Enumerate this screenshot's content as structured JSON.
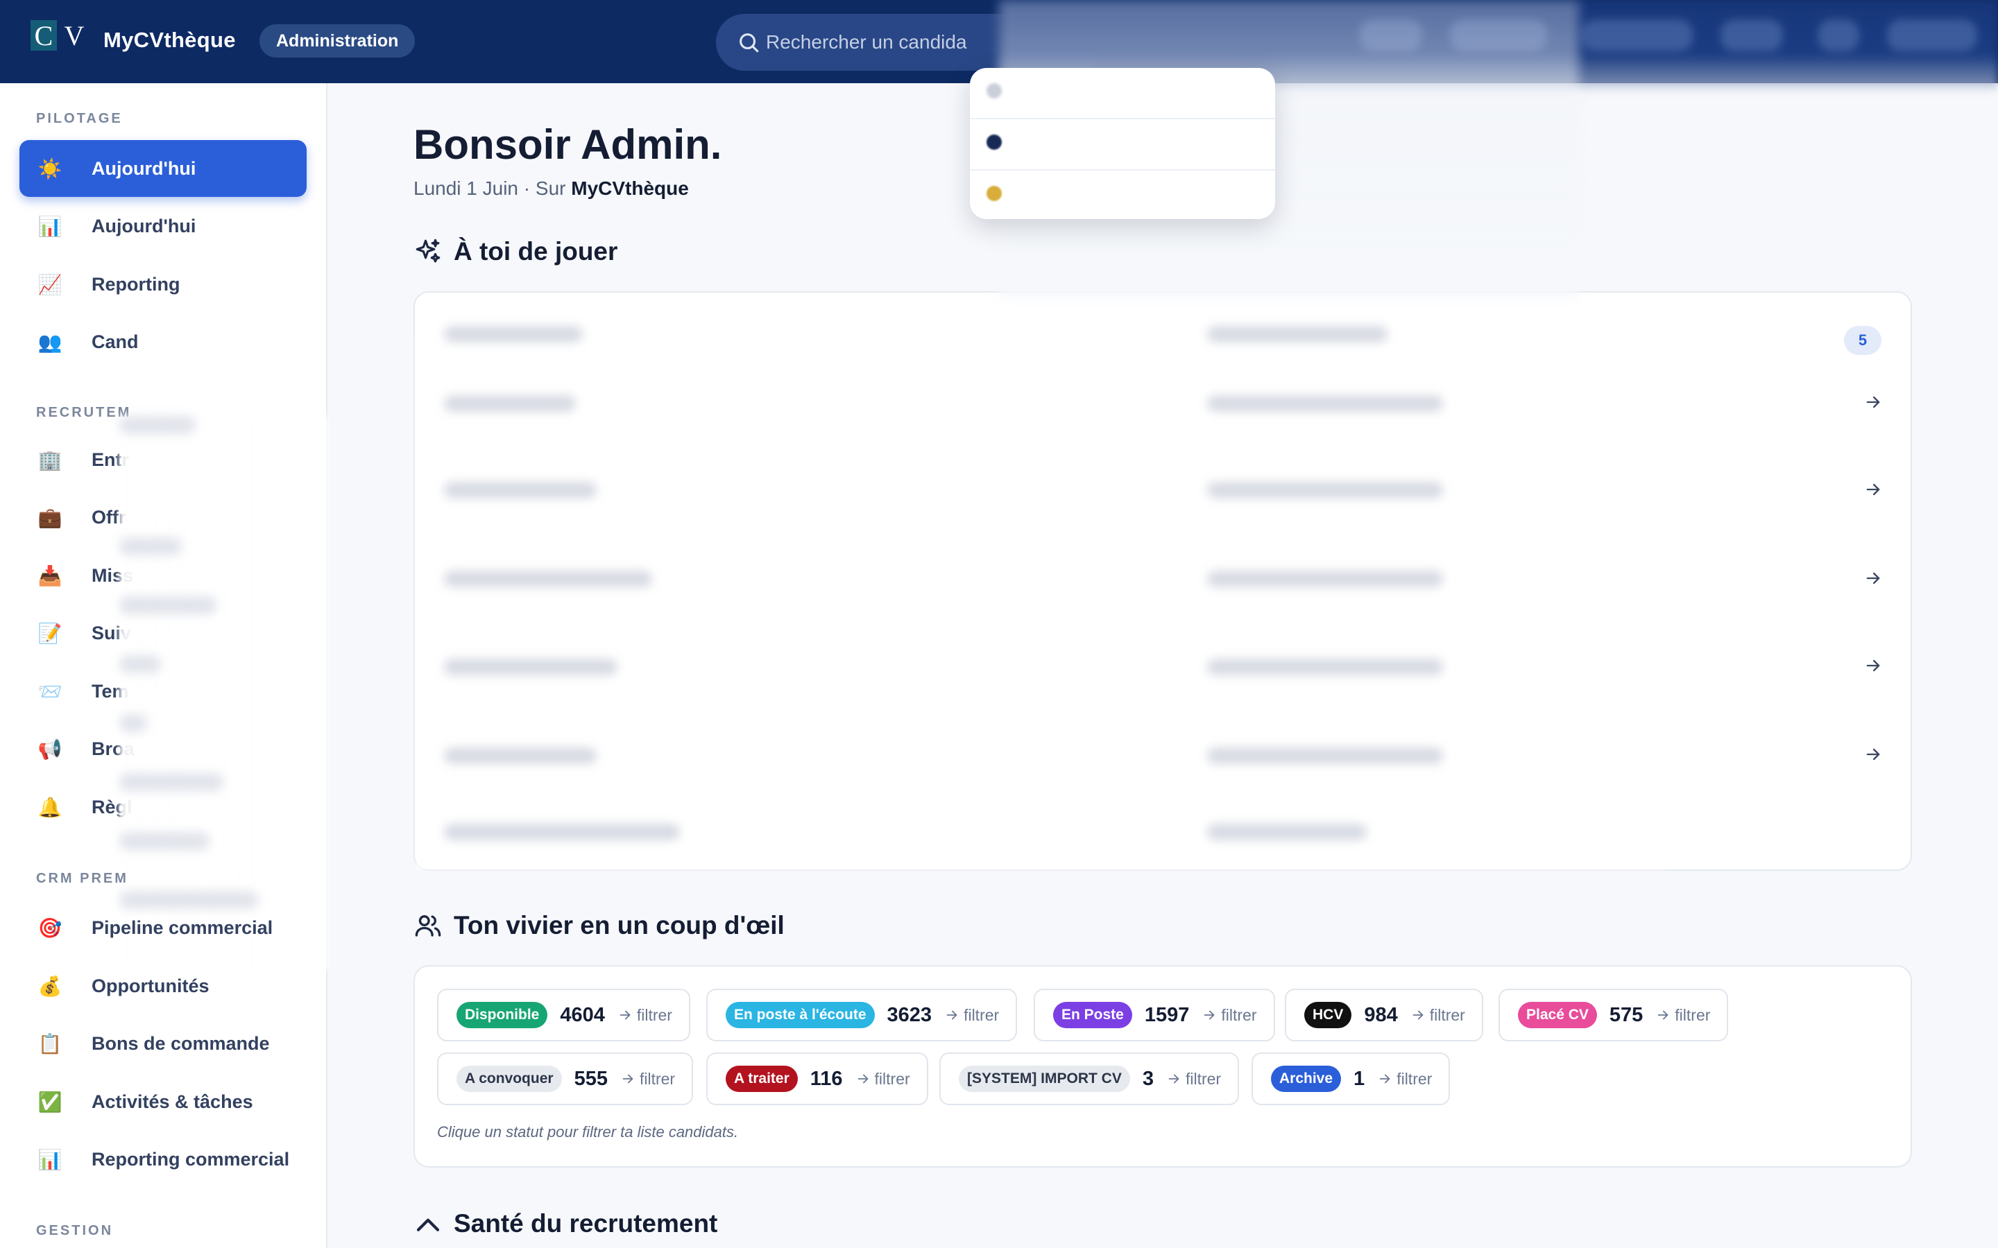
{
  "header": {
    "logo_left": "C",
    "logo_right": "V",
    "brand": "MyCVthèque",
    "admin_badge": "Administration",
    "search_placeholder": "Rechercher un candida"
  },
  "sidebar": {
    "sections": {
      "pilotage": "PILOTAGE",
      "recrutement": "RECRUTEM",
      "crm": "CRM PREM",
      "gestion": "GESTION"
    },
    "items": [
      {
        "label": "Aujourd'hui",
        "icon": "☀️",
        "icon_name": "sun-icon"
      },
      {
        "label": "Aujourd'hui",
        "icon": "📊",
        "icon_name": "bar-chart-icon"
      },
      {
        "label": "Reporting",
        "icon": "📈",
        "icon_name": "line-chart-icon"
      },
      {
        "label": "Cand",
        "icon": "👥",
        "icon_name": "users-icon"
      },
      {
        "label": "Entr",
        "icon": "🏢",
        "icon_name": "building-icon"
      },
      {
        "label": "Offr",
        "icon": "💼",
        "icon_name": "briefcase-icon"
      },
      {
        "label": "Miss",
        "icon": "📥",
        "icon_name": "inbox-icon"
      },
      {
        "label": "Suiv",
        "icon": "📝",
        "icon_name": "memo-icon"
      },
      {
        "label": "Tem",
        "icon": "📨",
        "icon_name": "envelope-icon"
      },
      {
        "label": "Broa",
        "icon": "📢",
        "icon_name": "megaphone-icon"
      },
      {
        "label": "Règl",
        "icon": "🔔",
        "icon_name": "bell-icon"
      },
      {
        "label": "Pipeline commercial",
        "icon": "🎯",
        "icon_name": "target-icon"
      },
      {
        "label": "Opportunités",
        "icon": "💰",
        "icon_name": "money-bag-icon"
      },
      {
        "label": "Bons de commande",
        "icon": "📋",
        "icon_name": "clipboard-icon"
      },
      {
        "label": "Activités & tâches",
        "icon": "✅",
        "icon_name": "check-icon"
      },
      {
        "label": "Reporting commercial",
        "icon": "📊",
        "icon_name": "bar-chart-icon"
      }
    ]
  },
  "main": {
    "greeting": "Bonsoir Admin.",
    "date": "Lundi 1 Juin · Sur ",
    "site": "MyCVthèque",
    "play_title": "À toi de jouer",
    "right_count": "5",
    "vivier_title": "Ton vivier en un coup d'œil",
    "vivier_hint": "Clique un statut pour filtrer ta liste candidats.",
    "health_title": "Santé du recrutement",
    "filter_label": "filtrer",
    "statuses": [
      {
        "label": "Disponible",
        "count": "4604",
        "color": "#17a673",
        "text": "#ffffff"
      },
      {
        "label": "En poste à l'écoute",
        "count": "3623",
        "color": "#2bb5e3",
        "text": "#ffffff"
      },
      {
        "label": "En Poste",
        "count": "1597",
        "color": "#7b3fe4",
        "text": "#ffffff"
      },
      {
        "label": "HCV",
        "count": "984",
        "color": "#111111",
        "text": "#ffffff"
      },
      {
        "label": "Placé CV",
        "count": "575",
        "color": "#e84c9a",
        "text": "#ffffff"
      },
      {
        "label": "A convoquer",
        "count": "555",
        "color": "#e6e9ee",
        "text": "#2c3548"
      },
      {
        "label": "A traiter",
        "count": "116",
        "color": "#b3121f",
        "text": "#ffffff"
      },
      {
        "label": "[SYSTEM] IMPORT CV",
        "count": "3",
        "color": "#e6e9ee",
        "text": "#2c3548"
      },
      {
        "label": "Archive",
        "count": "1",
        "color": "#2b5fd9",
        "text": "#ffffff"
      }
    ]
  }
}
